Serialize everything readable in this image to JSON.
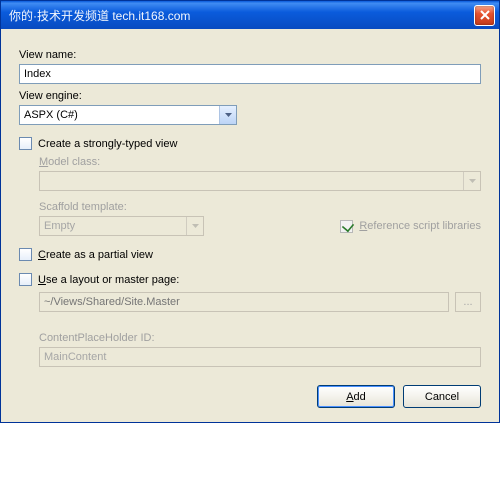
{
  "titlebar": {
    "watermark": "你的·技术开发频道 tech.it168.com"
  },
  "labels": {
    "view_name": "View name:",
    "view_engine": "View engine:",
    "create_strongly_typed": "Create a strongly-typed view",
    "model_class": "Model class:",
    "scaffold_template": "Scaffold template:",
    "reference_scripts": "Reference script libraries",
    "create_partial": "Create as a partial view",
    "use_layout": "Use a layout or master page:",
    "placeholder_hint": "~/Views/Shared/Site.Master",
    "content_placeholder_label": "ContentPlaceHolder ID:",
    "browse": "..."
  },
  "values": {
    "view_name": "Index",
    "view_engine": "ASPX (C#)",
    "scaffold_template": "Empty",
    "content_placeholder": "MainContent"
  },
  "checkboxes": {
    "strongly_typed": false,
    "reference_scripts": true,
    "create_partial": false,
    "use_layout": false
  },
  "buttons": {
    "add": "Add",
    "cancel": "Cancel"
  }
}
